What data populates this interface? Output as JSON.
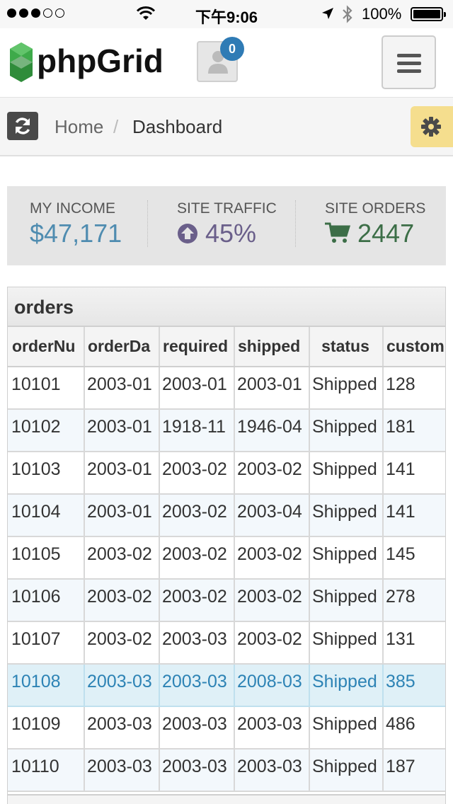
{
  "status_bar": {
    "time": "下午9:06",
    "battery": "100%",
    "signal": [
      "full",
      "full",
      "full",
      "empty",
      "empty"
    ]
  },
  "header": {
    "logo_text": "phpGrid",
    "notification_count": "0"
  },
  "breadcrumb": {
    "home": "Home",
    "separator": "/",
    "current": "Dashboard"
  },
  "stats": [
    {
      "label": "MY INCOME",
      "value": "$47,171",
      "icon": null,
      "color": "#4f8cb0"
    },
    {
      "label": "SITE TRAFFIC",
      "value": "45%",
      "icon": "arrow-up-circle-icon",
      "color": "#6a5f8a"
    },
    {
      "label": "SITE ORDERS",
      "value": "2447",
      "icon": "shopping-cart-icon",
      "color": "#3c6e47"
    }
  ],
  "grid": {
    "caption": "orders",
    "columns": [
      "orderNu",
      "orderDa",
      "required",
      "shipped",
      "status",
      "custom"
    ],
    "rows": [
      [
        "10101",
        "2003-01",
        "2003-01",
        "2003-01",
        "Shipped",
        "128"
      ],
      [
        "10102",
        "2003-01",
        "1918-11",
        "1946-04",
        "Shipped",
        "181"
      ],
      [
        "10103",
        "2003-01",
        "2003-02",
        "2003-02",
        "Shipped",
        "141"
      ],
      [
        "10104",
        "2003-01",
        "2003-02",
        "2003-04",
        "Shipped",
        "141"
      ],
      [
        "10105",
        "2003-02",
        "2003-02",
        "2003-02",
        "Shipped",
        "145"
      ],
      [
        "10106",
        "2003-02",
        "2003-02",
        "2003-02",
        "Shipped",
        "278"
      ],
      [
        "10107",
        "2003-02",
        "2003-03",
        "2003-02",
        "Shipped",
        "131"
      ],
      [
        "10108",
        "2003-03",
        "2003-03",
        "2008-03",
        "Shipped",
        "385"
      ],
      [
        "10109",
        "2003-03",
        "2003-03",
        "2003-03",
        "Shipped",
        "486"
      ],
      [
        "10110",
        "2003-03",
        "2003-03",
        "2003-03",
        "Shipped",
        "187"
      ]
    ],
    "selected_row": 7
  },
  "colors": {
    "logo_green": "#3eaa4a",
    "badge_blue": "#2f7bb5",
    "settings_yellow": "#f5de8e",
    "selected_row_text": "#2d83b5"
  }
}
